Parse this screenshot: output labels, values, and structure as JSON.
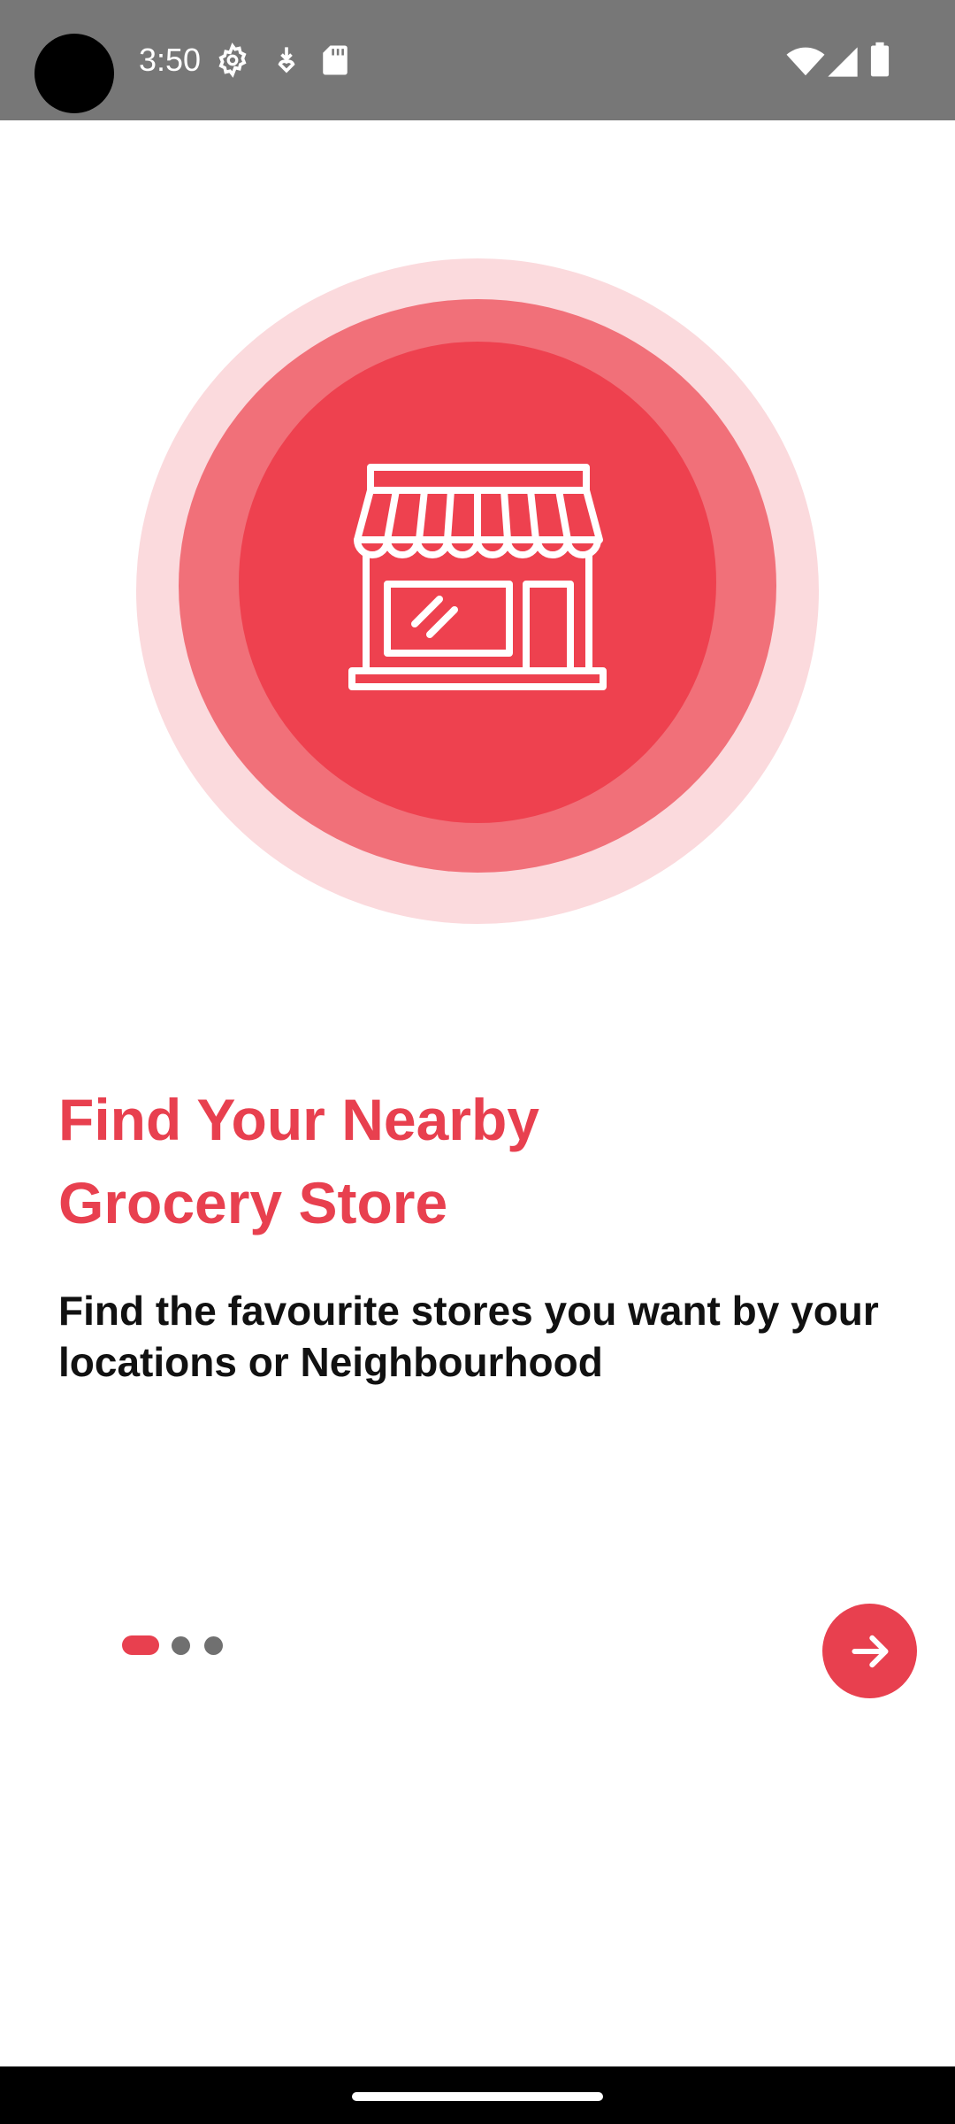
{
  "status_bar": {
    "time": "3:50",
    "left_icons": [
      "settings-gear-icon",
      "download-icon",
      "sd-card-icon"
    ],
    "right_icons": [
      "wifi-icon",
      "cellular-signal-icon",
      "battery-icon"
    ]
  },
  "onboarding": {
    "illustration_icon": "storefront-icon",
    "title_line1": "Find Your Nearby",
    "title_line2": "Grocery Store",
    "description": "Find the favourite stores you want by your locations or Neighbourhood",
    "page_count": 3,
    "current_page": 1,
    "next_button_icon": "arrow-right-icon"
  },
  "colors": {
    "accent": "#e8404f",
    "ring_light": "#fbdadd",
    "ring_mid": "#f17079",
    "status_bar": "#777777"
  }
}
